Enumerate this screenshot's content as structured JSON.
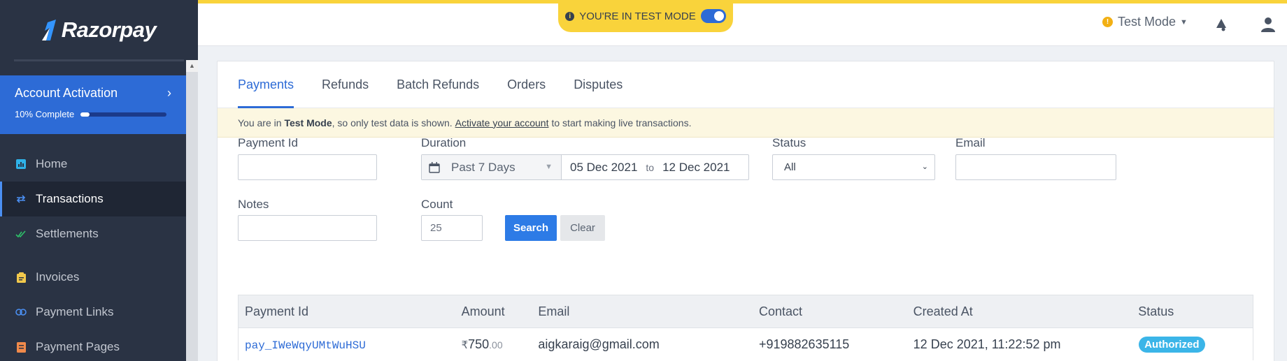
{
  "brand": {
    "name": "Razorpay"
  },
  "sidebar": {
    "activation": {
      "title": "Account Activation",
      "progress_text": "10% Complete",
      "progress": 0.1
    },
    "items": [
      {
        "label": "Home",
        "icon": "bar-chart-icon"
      },
      {
        "label": "Transactions",
        "icon": "swap-arrows-icon"
      },
      {
        "label": "Settlements",
        "icon": "double-check-icon"
      },
      {
        "label": "Invoices",
        "icon": "clipboard-icon"
      },
      {
        "label": "Payment Links",
        "icon": "link-icon"
      },
      {
        "label": "Payment Pages",
        "icon": "page-icon"
      }
    ]
  },
  "topbar": {
    "test_banner": "YOU'RE IN TEST MODE",
    "mode_label": "Test Mode",
    "mode_badge": "!"
  },
  "tabs": [
    "Payments",
    "Refunds",
    "Batch Refunds",
    "Orders",
    "Disputes"
  ],
  "notice": {
    "prefix": "You are in",
    "mode": "Test Mode",
    "middle": ", so only test data is shown.",
    "link": "Activate your account",
    "suffix": "to start making live transactions."
  },
  "filters": {
    "payment_id": {
      "label": "Payment Id",
      "value": ""
    },
    "duration": {
      "label": "Duration",
      "preset": "Past 7 Days",
      "from": "05 Dec 2021",
      "to_label": "to",
      "to": "12 Dec 2021"
    },
    "status": {
      "label": "Status",
      "value": "All"
    },
    "email": {
      "label": "Email",
      "value": ""
    },
    "notes": {
      "label": "Notes",
      "value": ""
    },
    "count": {
      "label": "Count",
      "value": "25"
    },
    "search_label": "Search",
    "clear_label": "Clear"
  },
  "table": {
    "headers": [
      "Payment Id",
      "Amount",
      "Email",
      "Contact",
      "Created At",
      "Status"
    ],
    "rows": [
      {
        "payment_id": "pay_IWeWqyUMtWuHSU",
        "currency": "₹",
        "amount_whole": "750",
        "amount_decimal": ".00",
        "email": "aigkaraig@gmail.com",
        "contact": "+919882635115",
        "created_at": "12 Dec 2021, 11:22:52 pm",
        "status": "Authorized"
      }
    ]
  }
}
